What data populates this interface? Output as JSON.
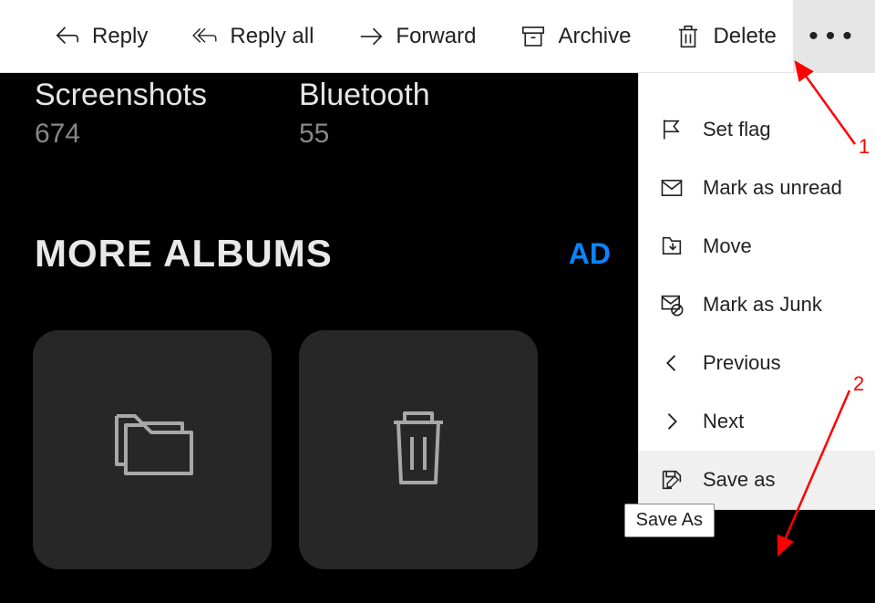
{
  "toolbar": {
    "reply": "Reply",
    "reply_all": "Reply all",
    "forward": "Forward",
    "archive": "Archive",
    "delete": "Delete"
  },
  "dropdown": {
    "items": [
      {
        "label": "Set flag"
      },
      {
        "label": "Mark as unread"
      },
      {
        "label": "Move"
      },
      {
        "label": "Mark as Junk"
      },
      {
        "label": "Previous"
      },
      {
        "label": "Next"
      },
      {
        "label": "Save as"
      }
    ]
  },
  "tooltip": {
    "text": "Save As"
  },
  "albums": {
    "screenshots": {
      "title": "Screenshots",
      "count": "674"
    },
    "bluetooth": {
      "title": "Bluetooth",
      "count": "55"
    },
    "more_label": "MORE ALBUMS",
    "add_label": "AD"
  },
  "annotations": {
    "one": "1",
    "two": "2"
  }
}
